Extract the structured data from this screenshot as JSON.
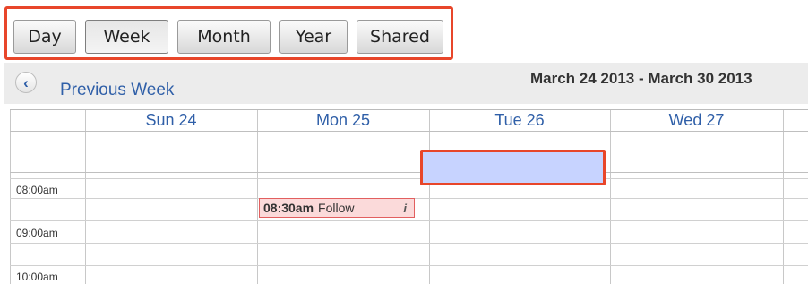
{
  "views": {
    "day": "Day",
    "week": "Week",
    "month": "Month",
    "year": "Year",
    "shared": "Shared",
    "active": "Week"
  },
  "nav": {
    "prev_icon": "chevron-left-icon",
    "prev_label": "Previous Week",
    "range_title": "March 24 2013 - March 30 2013"
  },
  "grid": {
    "days": [
      "Sun 24",
      "Mon 25",
      "Tue 26",
      "Wed 27"
    ],
    "times": [
      "08:00am",
      "09:00am",
      "10:00am"
    ]
  },
  "event": {
    "time": "08:30am",
    "title": "Follow",
    "info": "i"
  },
  "colors": {
    "highlight": "#e8462a",
    "link": "#2f5fa8",
    "event_bg": "#fbdada",
    "event_border": "#e25f5f",
    "selection_bg": "#c7d3ff"
  }
}
